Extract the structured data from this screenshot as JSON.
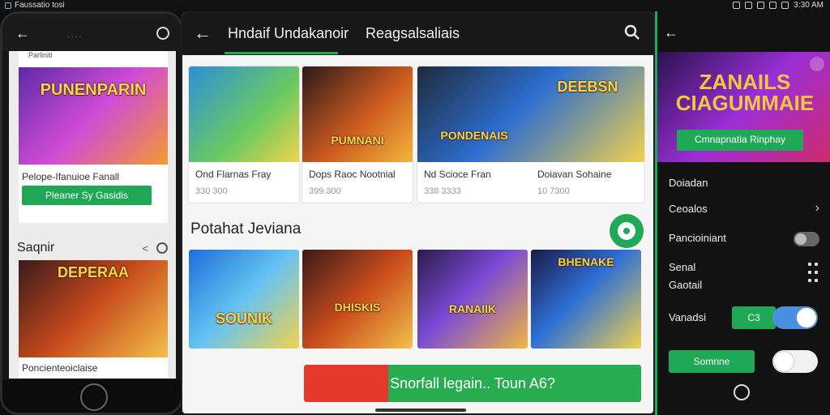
{
  "system_bar": {
    "app_label": "Faussatio tosi",
    "time": "3:30 AM"
  },
  "left_phone": {
    "card1": {
      "caption": "Parliniti",
      "banner_title": "PUNENPARIN",
      "title": "Pelope-Ifanuioe Fanall",
      "button": "Pleaner Sy Gasidis"
    },
    "section_title": "Saqnir",
    "card2": {
      "banner_title": "DEPERAA",
      "title": "Poncienteoiclaise"
    }
  },
  "tablet": {
    "tabs": [
      "Hndaif Undakanoir",
      "Reagsalsaliais"
    ],
    "row1": [
      {
        "name": "Ond Flarnas Fray",
        "price": "330 300",
        "art_label": ""
      },
      {
        "name": "Dops Raoc Nootnial",
        "price": "399.300",
        "art_label": "PUMNANI"
      },
      {
        "name": "Nd Scioce Fran",
        "price": "338 3333",
        "art_label": "PONDENAIS"
      },
      {
        "name": "Doiavan Sohaine",
        "price": "10 7300",
        "art_label": "DEEBSN"
      }
    ],
    "section2_title": "Potahat Jeviana",
    "row2_labels": [
      "SOUNIK",
      "DHISKIS",
      "RANAIIK",
      "BHENAKE"
    ],
    "cta_label": "Snorfall legain.. Toun A6?"
  },
  "right_panel": {
    "banner_title": "ZANAILS CIAGUMMAIE",
    "banner_button": "Cmnapnatia Rinphay",
    "items": [
      {
        "label": "Doiadan"
      },
      {
        "label": "Ceoalos"
      },
      {
        "label": "Pancioiniant"
      },
      {
        "label": "Senal"
      },
      {
        "label": "Gaotail"
      },
      {
        "label": "Vanadsi"
      }
    ],
    "small_green_label": "C3",
    "bottom_button": "Somnne"
  }
}
